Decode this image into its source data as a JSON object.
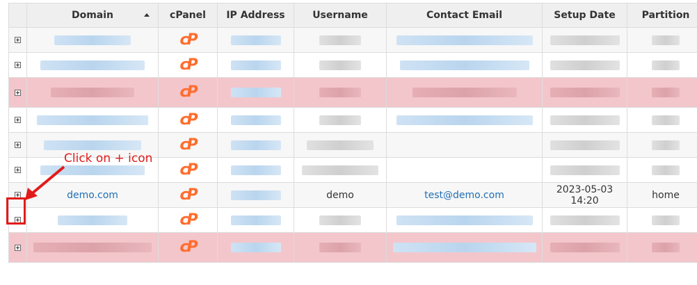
{
  "table": {
    "headers": {
      "domain": "Domain",
      "cpanel": "cPanel",
      "ip": "IP Address",
      "username": "Username",
      "email": "Contact Email",
      "setup": "Setup Date",
      "partition": "Partition"
    },
    "cpanel_icon_text": "cP",
    "demo_row": {
      "domain": "demo.com",
      "username": "demo",
      "email": "test@demo.com",
      "setup_date": "2023-05-03 14:20",
      "partition": "home"
    }
  },
  "annotation": {
    "text": "Click on + icon",
    "color": "#e11b1b"
  },
  "colors": {
    "cpanel_orange": "#ff6c2c",
    "highlight_row": "#f3c6cb",
    "link_blue": "#1f6fb5"
  }
}
